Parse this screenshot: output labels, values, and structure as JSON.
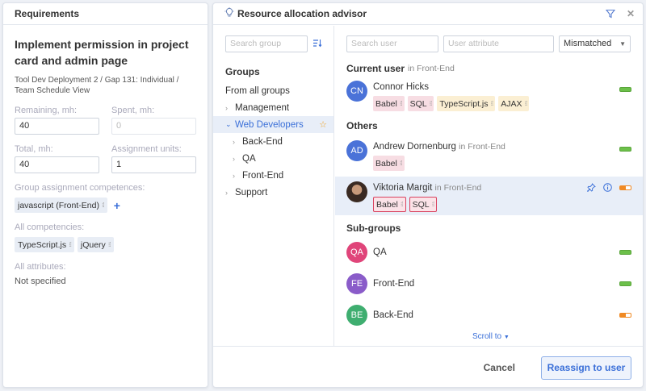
{
  "requirements": {
    "header": "Requirements",
    "title": "Implement permission in project card and admin page",
    "path": "Tool Dev Deployment 2 / Gap 131: Individual / Team Schedule View",
    "remaining_label": "Remaining, mh:",
    "remaining_value": "40",
    "spent_label": "Spent, mh:",
    "spent_value": "0",
    "total_label": "Total, mh:",
    "total_value": "40",
    "units_label": "Assignment units:",
    "units_value": "1",
    "group_comp_label": "Group assignment competences:",
    "group_comp": [
      "javascript (Front-End)"
    ],
    "all_comp_label": "All competencies:",
    "all_comp": [
      "TypeScript.js",
      "jQuery"
    ],
    "attrs_label": "All attributes:",
    "attrs_value": "Not specified"
  },
  "advisor": {
    "header": "Resource allocation advisor",
    "search_group_placeholder": "Search group",
    "groups_title": "Groups",
    "tree": [
      {
        "label": "From all groups"
      },
      {
        "label": "Management"
      },
      {
        "label": "Web Developers"
      },
      {
        "label": "Back-End"
      },
      {
        "label": "QA"
      },
      {
        "label": "Front-End"
      },
      {
        "label": "Support"
      }
    ],
    "search_user_placeholder": "Search user",
    "user_attr_placeholder": "User attribute",
    "filter_select": "Mismatched",
    "current_user_label": "Current user",
    "current_user_in": "in Front-End",
    "current_user": {
      "initials": "CN",
      "name": "Connor Hicks",
      "color": "#4a72d8",
      "tags": [
        "Babel",
        "SQL",
        "TypeScript.js",
        "AJAX"
      ]
    },
    "others_label": "Others",
    "others": [
      {
        "initials": "AD",
        "name": "Andrew Dornenburg",
        "dep": "in Front-End",
        "color": "#4a72d8",
        "tags": [
          "Babel"
        ]
      },
      {
        "initials": "",
        "name": "Viktoria Margit",
        "dep": "in Front-End",
        "tags": [
          "Babel",
          "SQL"
        ]
      }
    ],
    "subgroups_label": "Sub-groups",
    "subgroups": [
      {
        "initials": "QA",
        "name": "QA",
        "color": "#e0457a"
      },
      {
        "initials": "FE",
        "name": "Front-End",
        "color": "#8a5cc9"
      },
      {
        "initials": "BE",
        "name": "Back-End",
        "color": "#3fae70"
      }
    ],
    "scroll_to": "Scroll to",
    "cancel": "Cancel",
    "reassign": "Reassign to user"
  }
}
